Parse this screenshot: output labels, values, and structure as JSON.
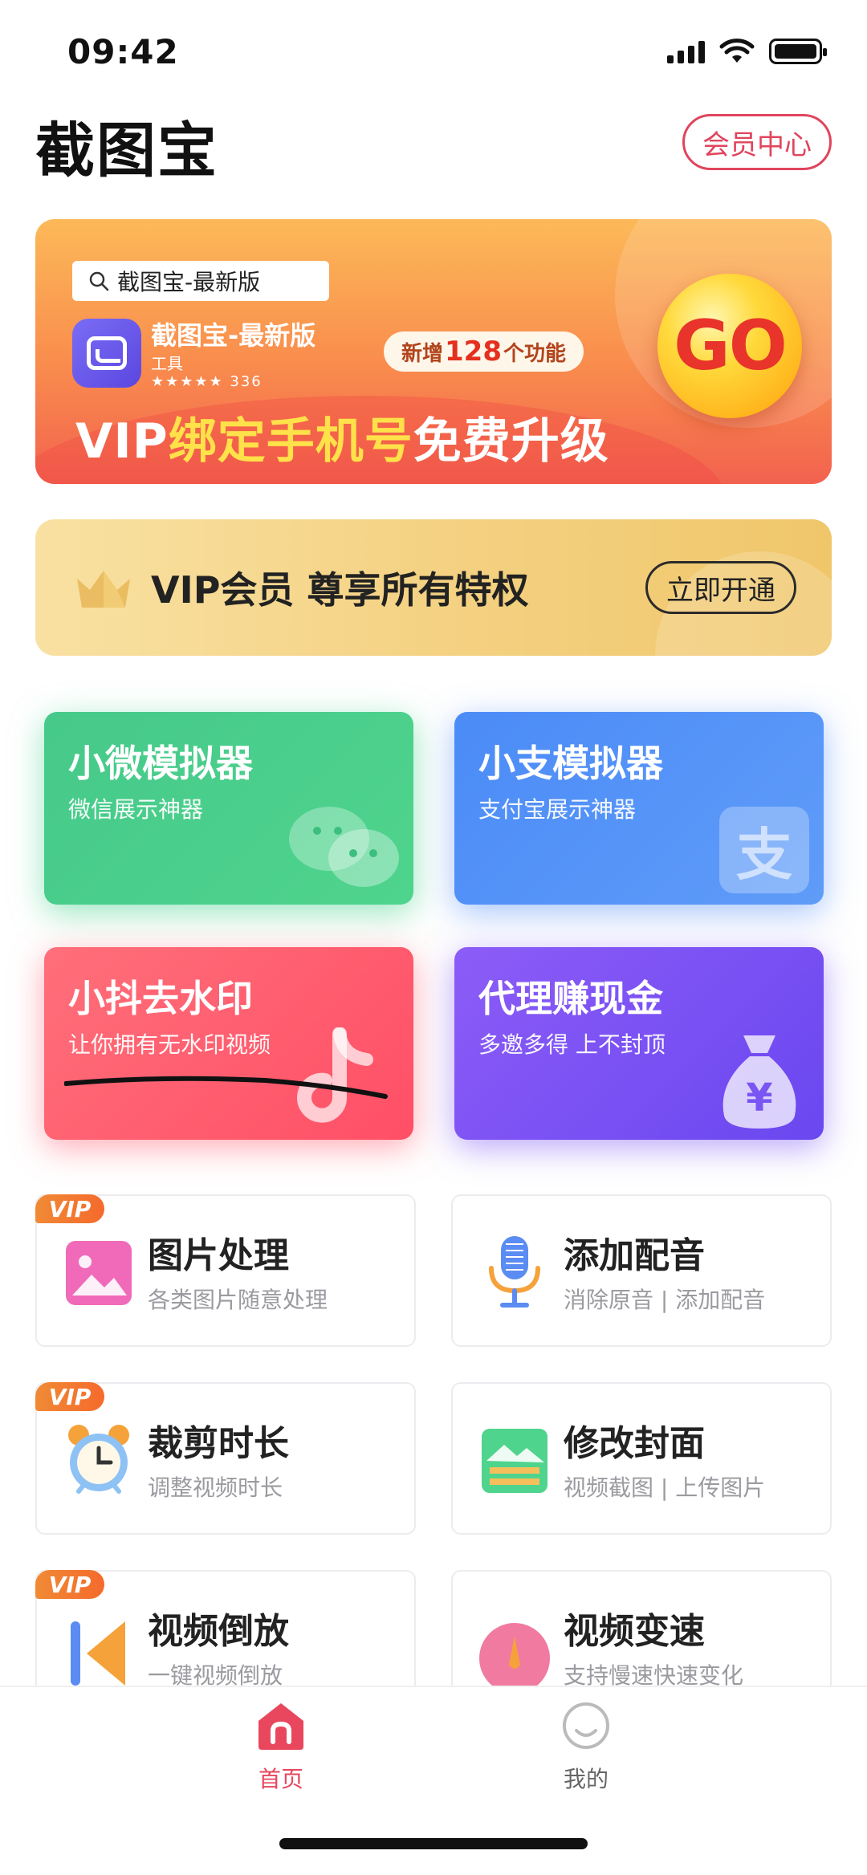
{
  "status_bar": {
    "time": "09:42"
  },
  "header": {
    "title": "截图宝",
    "member_center": "会员中心"
  },
  "banner": {
    "search_text": "截图宝-最新版",
    "app_name": "截图宝-最新版",
    "app_category": "工具",
    "app_rating": "★★★★★ 336",
    "badge_prefix": "新增",
    "badge_number": "128",
    "badge_suffix": "个功能",
    "headline_vip": "VIP",
    "headline_bind": "绑定手机号",
    "headline_free": "免费升级",
    "go_label": "GO"
  },
  "vip_bar": {
    "text": "VIP会员 尊享所有特权",
    "button": "立即开通"
  },
  "feature_cards": [
    {
      "title": "小微模拟器",
      "subtitle": "微信展示神器"
    },
    {
      "title": "小支模拟器",
      "subtitle": "支付宝展示神器"
    },
    {
      "title": "小抖去水印",
      "subtitle": "让你拥有无水印视频"
    },
    {
      "title": "代理赚现金",
      "subtitle": "多邀多得 上不封顶"
    }
  ],
  "tools": [
    {
      "title": "图片处理",
      "subtitle": "各类图片随意处理",
      "vip": "VIP"
    },
    {
      "title": "添加配音",
      "subtitle": "消除原音 | 添加配音"
    },
    {
      "title": "裁剪时长",
      "subtitle": "调整视频时长",
      "vip": "VIP"
    },
    {
      "title": "修改封面",
      "subtitle": "视频截图 | 上传图片"
    },
    {
      "title": "视频倒放",
      "subtitle": "一键视频倒放",
      "vip": "VIP"
    },
    {
      "title": "视频变速",
      "subtitle": "支持慢速快速变化"
    }
  ],
  "tabbar": {
    "home": "首页",
    "mine": "我的",
    "active_color": "#e8475e"
  },
  "colors": {
    "accent": "#e0455d",
    "vip_orange": "#f56a2c"
  }
}
